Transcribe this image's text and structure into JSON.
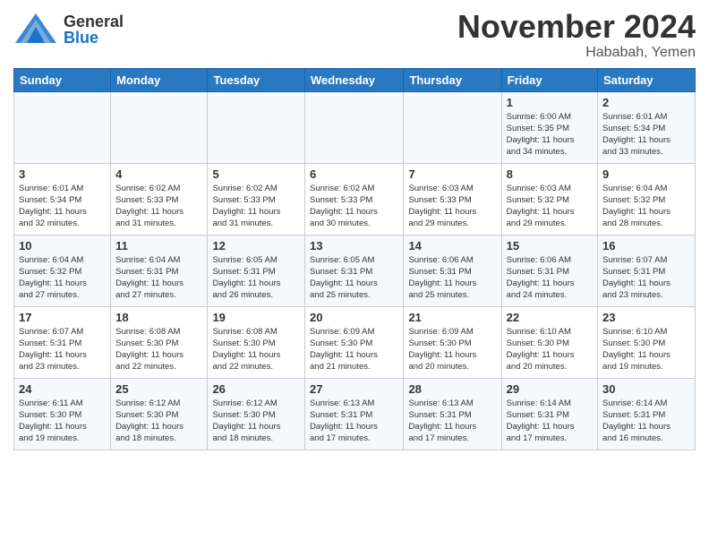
{
  "header": {
    "logo_general": "General",
    "logo_blue": "Blue",
    "month_title": "November 2024",
    "location": "Hababah, Yemen"
  },
  "weekdays": [
    "Sunday",
    "Monday",
    "Tuesday",
    "Wednesday",
    "Thursday",
    "Friday",
    "Saturday"
  ],
  "weeks": [
    [
      {
        "day": "",
        "info": ""
      },
      {
        "day": "",
        "info": ""
      },
      {
        "day": "",
        "info": ""
      },
      {
        "day": "",
        "info": ""
      },
      {
        "day": "",
        "info": ""
      },
      {
        "day": "1",
        "info": "Sunrise: 6:00 AM\nSunset: 5:35 PM\nDaylight: 11 hours\nand 34 minutes."
      },
      {
        "day": "2",
        "info": "Sunrise: 6:01 AM\nSunset: 5:34 PM\nDaylight: 11 hours\nand 33 minutes."
      }
    ],
    [
      {
        "day": "3",
        "info": "Sunrise: 6:01 AM\nSunset: 5:34 PM\nDaylight: 11 hours\nand 32 minutes."
      },
      {
        "day": "4",
        "info": "Sunrise: 6:02 AM\nSunset: 5:33 PM\nDaylight: 11 hours\nand 31 minutes."
      },
      {
        "day": "5",
        "info": "Sunrise: 6:02 AM\nSunset: 5:33 PM\nDaylight: 11 hours\nand 31 minutes."
      },
      {
        "day": "6",
        "info": "Sunrise: 6:02 AM\nSunset: 5:33 PM\nDaylight: 11 hours\nand 30 minutes."
      },
      {
        "day": "7",
        "info": "Sunrise: 6:03 AM\nSunset: 5:33 PM\nDaylight: 11 hours\nand 29 minutes."
      },
      {
        "day": "8",
        "info": "Sunrise: 6:03 AM\nSunset: 5:32 PM\nDaylight: 11 hours\nand 29 minutes."
      },
      {
        "day": "9",
        "info": "Sunrise: 6:04 AM\nSunset: 5:32 PM\nDaylight: 11 hours\nand 28 minutes."
      }
    ],
    [
      {
        "day": "10",
        "info": "Sunrise: 6:04 AM\nSunset: 5:32 PM\nDaylight: 11 hours\nand 27 minutes."
      },
      {
        "day": "11",
        "info": "Sunrise: 6:04 AM\nSunset: 5:31 PM\nDaylight: 11 hours\nand 27 minutes."
      },
      {
        "day": "12",
        "info": "Sunrise: 6:05 AM\nSunset: 5:31 PM\nDaylight: 11 hours\nand 26 minutes."
      },
      {
        "day": "13",
        "info": "Sunrise: 6:05 AM\nSunset: 5:31 PM\nDaylight: 11 hours\nand 25 minutes."
      },
      {
        "day": "14",
        "info": "Sunrise: 6:06 AM\nSunset: 5:31 PM\nDaylight: 11 hours\nand 25 minutes."
      },
      {
        "day": "15",
        "info": "Sunrise: 6:06 AM\nSunset: 5:31 PM\nDaylight: 11 hours\nand 24 minutes."
      },
      {
        "day": "16",
        "info": "Sunrise: 6:07 AM\nSunset: 5:31 PM\nDaylight: 11 hours\nand 23 minutes."
      }
    ],
    [
      {
        "day": "17",
        "info": "Sunrise: 6:07 AM\nSunset: 5:31 PM\nDaylight: 11 hours\nand 23 minutes."
      },
      {
        "day": "18",
        "info": "Sunrise: 6:08 AM\nSunset: 5:30 PM\nDaylight: 11 hours\nand 22 minutes."
      },
      {
        "day": "19",
        "info": "Sunrise: 6:08 AM\nSunset: 5:30 PM\nDaylight: 11 hours\nand 22 minutes."
      },
      {
        "day": "20",
        "info": "Sunrise: 6:09 AM\nSunset: 5:30 PM\nDaylight: 11 hours\nand 21 minutes."
      },
      {
        "day": "21",
        "info": "Sunrise: 6:09 AM\nSunset: 5:30 PM\nDaylight: 11 hours\nand 20 minutes."
      },
      {
        "day": "22",
        "info": "Sunrise: 6:10 AM\nSunset: 5:30 PM\nDaylight: 11 hours\nand 20 minutes."
      },
      {
        "day": "23",
        "info": "Sunrise: 6:10 AM\nSunset: 5:30 PM\nDaylight: 11 hours\nand 19 minutes."
      }
    ],
    [
      {
        "day": "24",
        "info": "Sunrise: 6:11 AM\nSunset: 5:30 PM\nDaylight: 11 hours\nand 19 minutes."
      },
      {
        "day": "25",
        "info": "Sunrise: 6:12 AM\nSunset: 5:30 PM\nDaylight: 11 hours\nand 18 minutes."
      },
      {
        "day": "26",
        "info": "Sunrise: 6:12 AM\nSunset: 5:30 PM\nDaylight: 11 hours\nand 18 minutes."
      },
      {
        "day": "27",
        "info": "Sunrise: 6:13 AM\nSunset: 5:31 PM\nDaylight: 11 hours\nand 17 minutes."
      },
      {
        "day": "28",
        "info": "Sunrise: 6:13 AM\nSunset: 5:31 PM\nDaylight: 11 hours\nand 17 minutes."
      },
      {
        "day": "29",
        "info": "Sunrise: 6:14 AM\nSunset: 5:31 PM\nDaylight: 11 hours\nand 17 minutes."
      },
      {
        "day": "30",
        "info": "Sunrise: 6:14 AM\nSunset: 5:31 PM\nDaylight: 11 hours\nand 16 minutes."
      }
    ]
  ]
}
